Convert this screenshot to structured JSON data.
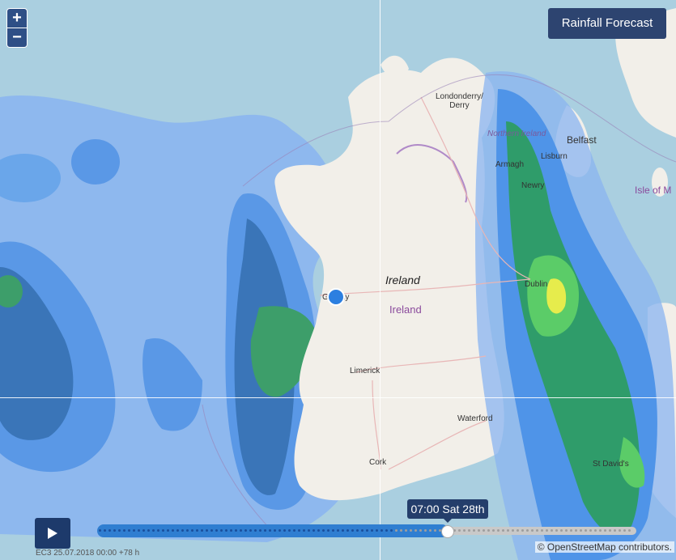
{
  "map": {
    "title": "Rainfall Forecast",
    "zoom_in": "+",
    "zoom_out": "−",
    "labels": {
      "londonderry": "Londonderry/\nDerry",
      "northern_ireland": "Northern Ireland",
      "belfast": "Belfast",
      "lisburn": "Lisburn",
      "armagh": "Armagh",
      "newry": "Newry",
      "isle_of_man": "Isle of M",
      "ireland_country": "Ireland",
      "ireland_region": "Ireland",
      "dublin": "Dublin",
      "galway": "Galway",
      "limerick": "Limerick",
      "waterford": "Waterford",
      "cork": "Cork",
      "st_davids": "St David's"
    },
    "colors": {
      "sea": "#aacfe0",
      "land": "#f2efe9",
      "rain_light": "#8ab4f0",
      "rain_mid": "#4f94e8",
      "rain_heavy": "#2f9c6a",
      "rain_peak": "#e6ec4c"
    }
  },
  "timeline": {
    "current_time": "07:00 Sat 28th",
    "run_info": "EC3 25.07.2018 00:00 +78 h",
    "progress_fraction": 0.55
  },
  "attribution": "© OpenStreetMap contributors."
}
